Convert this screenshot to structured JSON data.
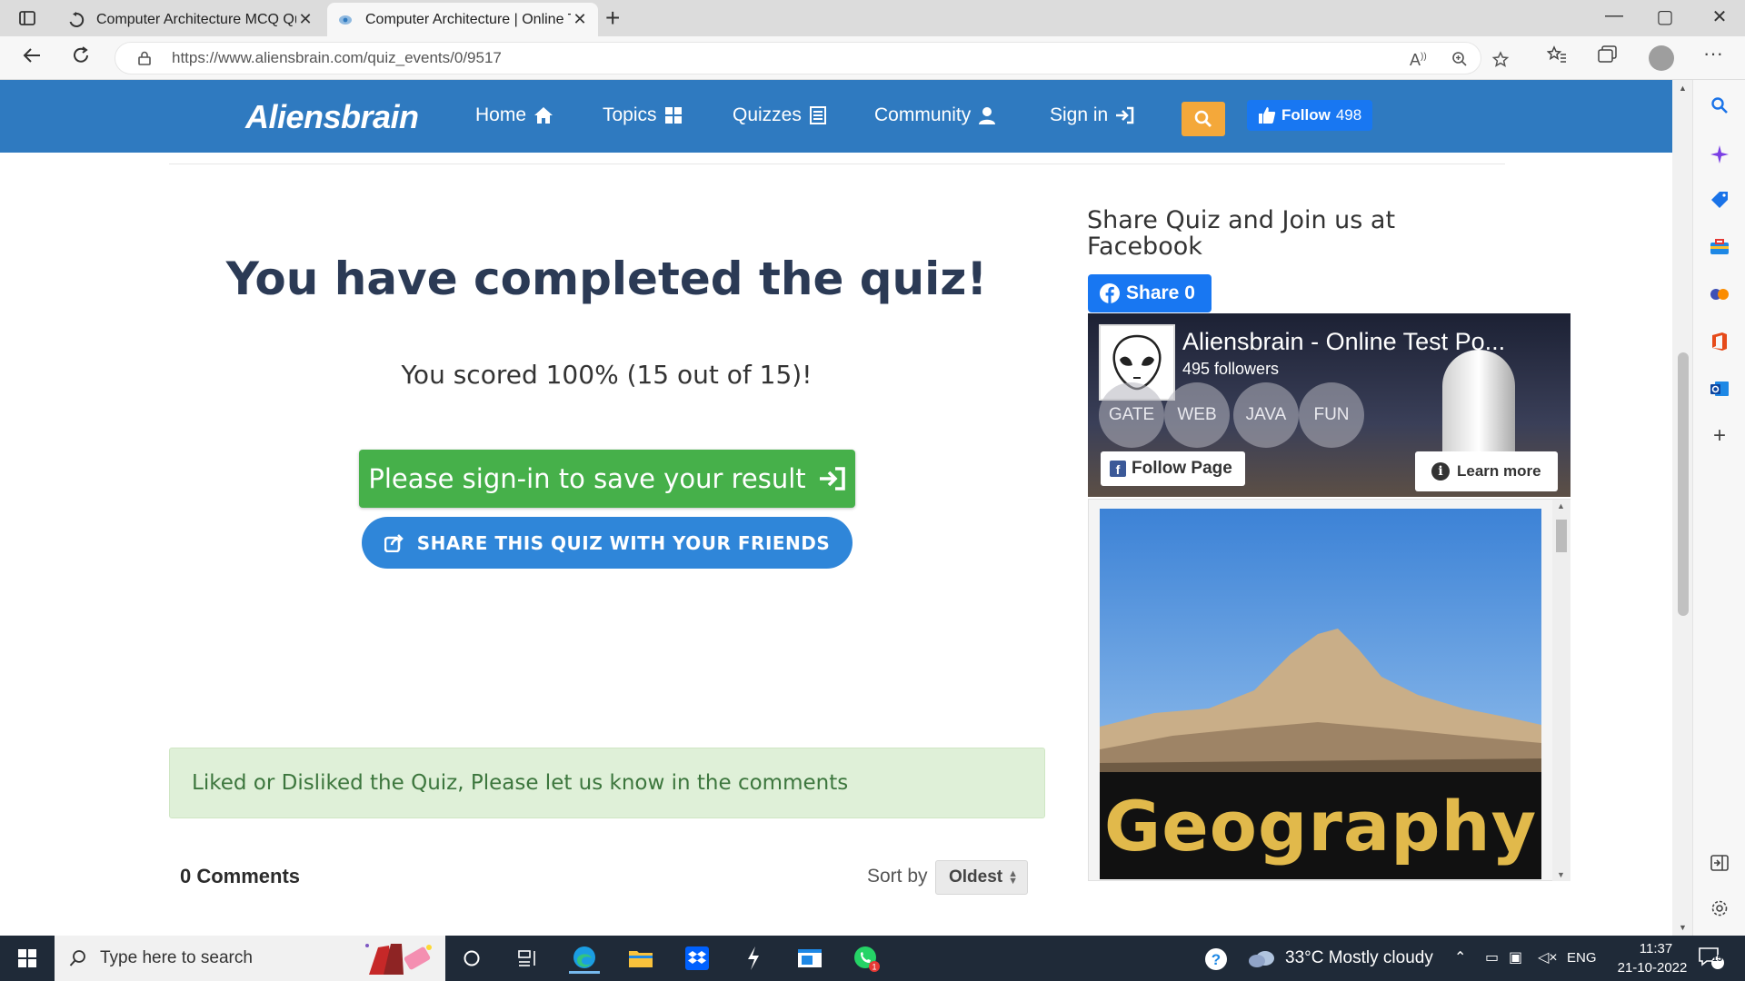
{
  "browser": {
    "tabs": [
      {
        "title": "Computer Architecture MCQ Qui",
        "close": "✕",
        "icon": "loading-icon"
      },
      {
        "title": "Computer Architecture | Online T",
        "close": "✕",
        "icon": "aliensbrain-favicon",
        "active": true
      }
    ],
    "new_tab": "+",
    "url": "https://www.aliensbrain.com/quiz_events/0/9517",
    "window_controls": [
      "—",
      "▢",
      "✕"
    ],
    "more_menu": "···"
  },
  "site": {
    "logo": "Aliensbrain",
    "nav": [
      {
        "label": "Home",
        "icon": "home-icon"
      },
      {
        "label": "Topics",
        "icon": "grid-icon"
      },
      {
        "label": "Quizzes",
        "icon": "list-icon"
      },
      {
        "label": "Community",
        "icon": "user-icon"
      },
      {
        "label": "Sign in",
        "icon": "sign-in-icon"
      }
    ],
    "fb_follow": {
      "label": "Follow",
      "count": "498"
    }
  },
  "quiz_result": {
    "title": "You have completed the quiz!",
    "score": "You scored 100% (15 out of 15)!",
    "signin_button": "Please sign-in to save your result",
    "share_button": "SHARE THIS QUIZ WITH YOUR FRIENDS"
  },
  "feedback": "Liked or Disliked the Quiz, Please let us know in the comments",
  "comments": {
    "count_label": "0 Comments",
    "sort_label": "Sort by",
    "sort_value": "Oldest"
  },
  "sidebar_widget": {
    "heading": "Share Quiz and Join us at Facebook",
    "share_button": "Share 0",
    "page_name": "Aliensbrain - Online Test Po...",
    "followers": "495 followers",
    "topics": [
      "GATE",
      "WEB",
      "JAVA",
      "FUN"
    ],
    "follow_page": "Follow Page",
    "learn_more": "Learn more",
    "feed_caption": "Geography"
  },
  "taskbar": {
    "search_placeholder": "Type here to search",
    "weather": "33°C  Mostly cloudy",
    "lang": "ENG",
    "time": "11:37",
    "date": "21-10-2022",
    "notification_count": "15"
  },
  "colors": {
    "header": "#2f7ac0",
    "signin_green": "#46b04a",
    "share_blue": "#2f86d9",
    "search_orange": "#f4a83a",
    "facebook": "#1877f2"
  }
}
